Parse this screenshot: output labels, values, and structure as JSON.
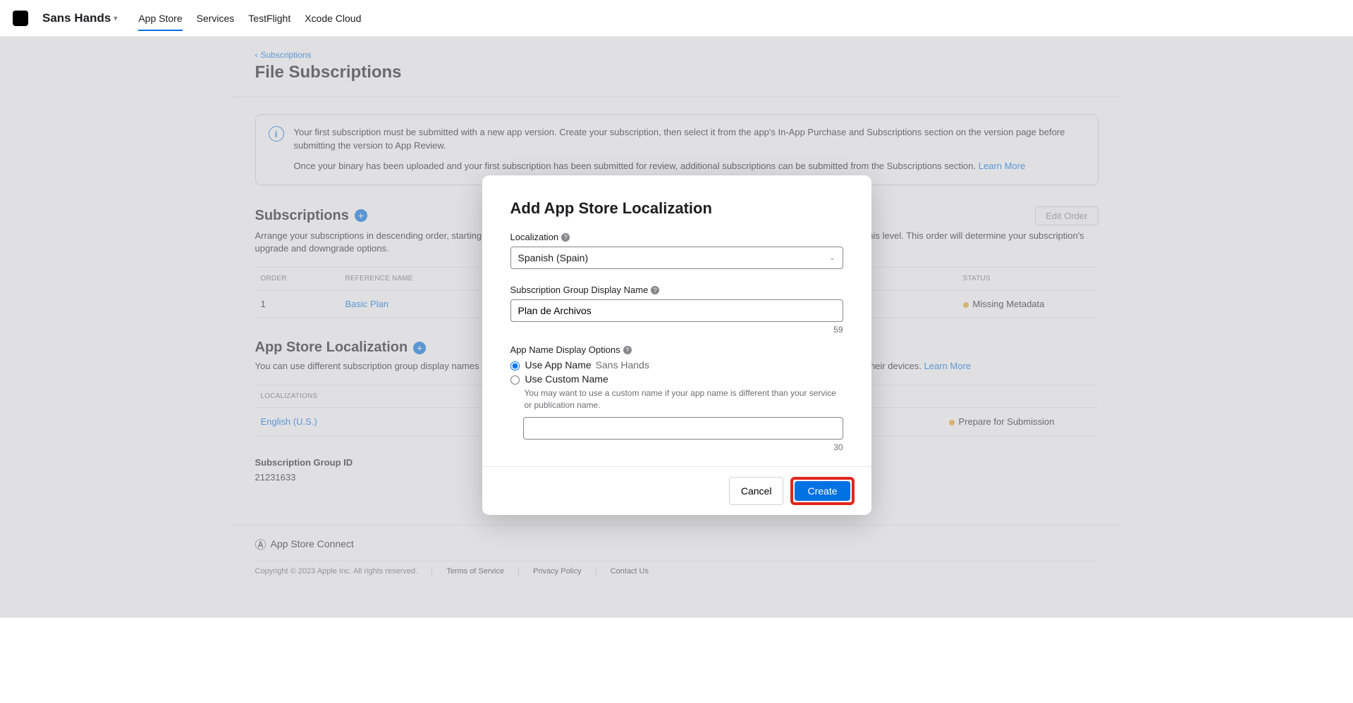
{
  "header": {
    "app_name": "Sans Hands",
    "tabs": [
      "App Store",
      "Services",
      "TestFlight",
      "Xcode Cloud"
    ],
    "active_tab_index": 0
  },
  "breadcrumb": {
    "label": "Subscriptions"
  },
  "page_title": "File Subscriptions",
  "info_banner": {
    "p1": "Your first subscription must be submitted with a new app version. Create your subscription, then select it from the app's In-App Purchase and Subscriptions section on the version page before submitting the version to App Review.",
    "p2": "Once your binary has been uploaded and your first subscription has been submitted for review, additional subscriptions can be submitted from the Subscriptions section.",
    "learn_more": "Learn More"
  },
  "subscriptions": {
    "title": "Subscriptions",
    "edit_btn": "Edit Order",
    "desc": "Arrange your subscriptions in descending order, starting with the one that offers the highest level of service. Users can only switch subscriptions within this level. This order will determine your subscription's upgrade and downgrade options.",
    "cols": {
      "order": "ORDER",
      "ref": "REFERENCE NAME",
      "status": "STATUS"
    },
    "rows": [
      {
        "order": "1",
        "ref": "Basic Plan",
        "status": "Missing Metadata"
      }
    ]
  },
  "localization": {
    "title": "App Store Localization",
    "desc": "You can use different subscription group display names for each App Store territory. These will be seen by users when managing their subscriptions on their devices.",
    "learn_more": "Learn More",
    "cols": {
      "loc": "LOCALIZATIONS"
    },
    "rows": [
      {
        "lang": "English (U.S.)",
        "status": "Prepare for Submission"
      }
    ]
  },
  "group_id": {
    "label": "Subscription Group ID",
    "value": "21231633"
  },
  "footer": {
    "brand": "App Store Connect",
    "copyright": "Copyright © 2023 Apple Inc. All rights reserved.",
    "links": [
      "Terms of Service",
      "Privacy Policy",
      "Contact Us"
    ]
  },
  "modal": {
    "title": "Add App Store Localization",
    "loc_label": "Localization",
    "loc_value": "Spanish (Spain)",
    "group_name_label": "Subscription Group Display Name",
    "group_name_value": "Plan de Archivos",
    "group_name_counter": "59",
    "options_label": "App Name Display Options",
    "use_app_name": "Use App Name",
    "app_name_value": "Sans Hands",
    "use_custom": "Use Custom Name",
    "custom_hint": "You may want to use a custom name if your app name is different than your service or publication name.",
    "custom_counter": "30",
    "cancel": "Cancel",
    "create": "Create"
  }
}
